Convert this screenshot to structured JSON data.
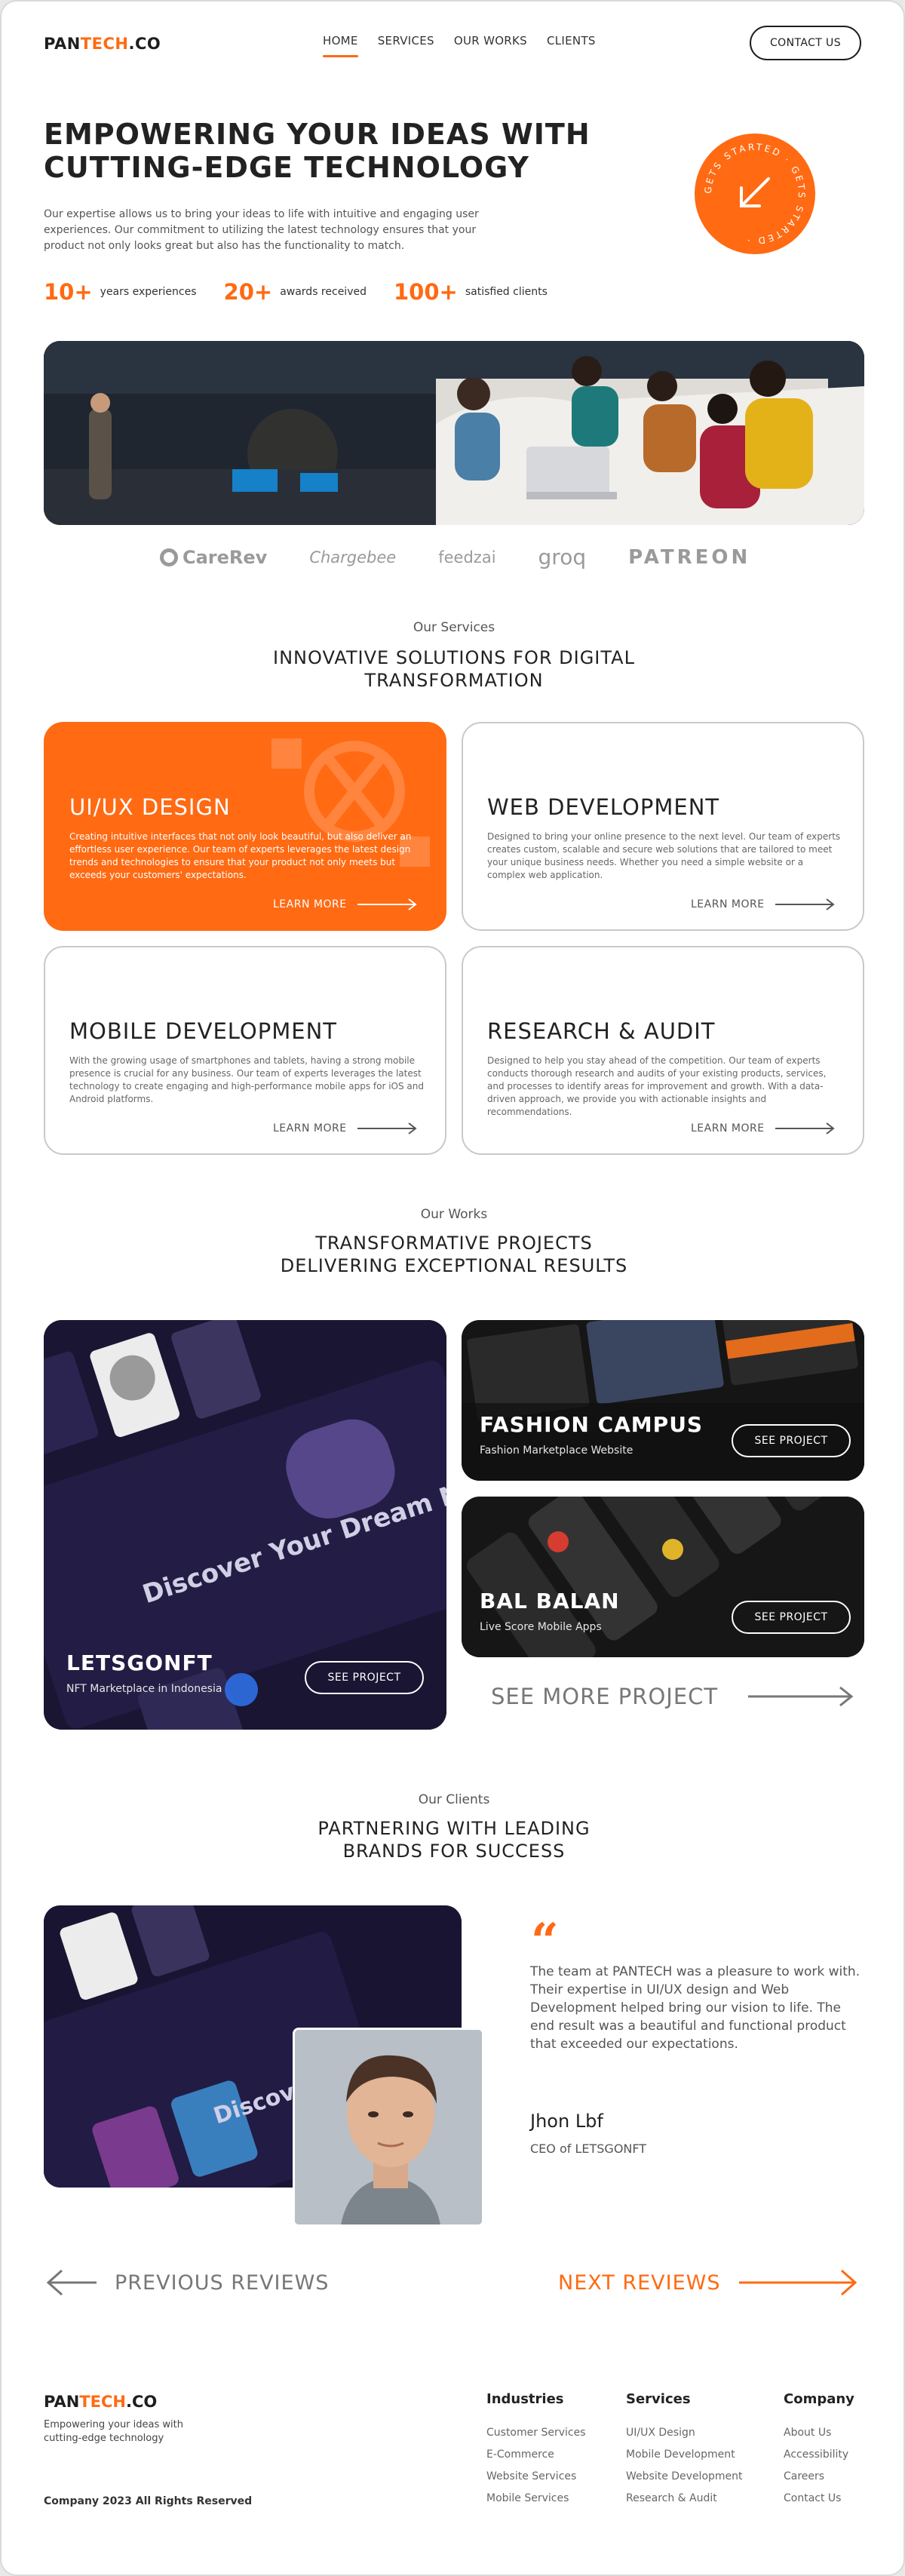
{
  "nav": {
    "logo_main": "PAN",
    "logo_accent": "TECH",
    "logo_suffix": ".CO",
    "items": [
      "HOME",
      "SERVICES",
      "OUR WORKS",
      "CLIENTS"
    ],
    "contact": "CONTACT US"
  },
  "hero": {
    "title": "EMPOWERING YOUR IDEAS WITH CUTTING-EDGE TECHNOLOGY",
    "description": "Our expertise allows us to bring your ideas to life with intuitive and engaging user experiences. Our commitment to utilizing the latest technology ensures that your product not only looks great but also has the functionality to match.",
    "badge_text": "GETS STARTED · GETS STARTED · ",
    "stats": [
      {
        "value": "10+",
        "label": "years experiences"
      },
      {
        "value": "20+",
        "label": "awards received"
      },
      {
        "value": "100+",
        "label": "satisfied clients"
      }
    ]
  },
  "brands": [
    "CareRev",
    "Chargebee",
    "feedzai",
    "groq",
    "PATREON"
  ],
  "services": {
    "kicker": "Our Services",
    "title": "INNOVATIVE SOLUTIONS FOR DIGITAL TRANSFORMATION",
    "items": [
      {
        "title": "UI/UX DESIGN",
        "desc": "Creating intuitive interfaces that not only look beautiful, but also deliver an effortless user experience. Our team of experts leverages the latest design trends and technologies to ensure that your product not only meets but exceeds your customers' expectations.",
        "link": "LEARN MORE"
      },
      {
        "title": "WEB DEVELOPMENT",
        "desc": "Designed to bring your online presence to the next level. Our team of experts creates custom, scalable and secure web solutions that are tailored to meet your unique business needs. Whether you need a simple website or a complex web application.",
        "link": "LEARN MORE"
      },
      {
        "title": "MOBILE DEVELOPMENT",
        "desc": "With the growing usage of smartphones and tablets, having a strong mobile presence is crucial for any business. Our team of experts leverages the latest technology to create engaging and high-performance mobile apps for iOS and Android platforms.",
        "link": "LEARN MORE"
      },
      {
        "title": "RESEARCH & AUDIT",
        "desc": "Designed to help you stay ahead of the competition. Our team of experts conducts thorough research and audits of your existing products, services, and processes to identify areas for improvement and growth. With a data-driven approach, we provide you with actionable insights and recommendations.",
        "link": "LEARN MORE"
      }
    ]
  },
  "works": {
    "kicker": "Our Works",
    "title_line1": "TRANSFORMATIVE PROJECTS",
    "title_line2": "DELIVERING EXCEPTIONAL RESULTS",
    "projects": [
      {
        "title": "LETSGONFT",
        "subtitle": "NFT Marketplace in Indonesia",
        "button": "SEE PROJECT",
        "art_text": "Discover Your Dream NFT's in Your Gallery"
      },
      {
        "title": "FASHION CAMPUS",
        "subtitle": "Fashion Marketplace Website",
        "button": "SEE PROJECT"
      },
      {
        "title": "BAL BALAN",
        "subtitle": "Live Score Mobile Apps",
        "button": "SEE PROJECT"
      }
    ],
    "see_more": "SEE MORE PROJECT"
  },
  "clients": {
    "kicker": "Our Clients",
    "title_line1": "PARTNERING WITH LEADING",
    "title_line2": "BRANDS FOR SUCCESS",
    "quote": "The team at PANTECH was a pleasure to work with. Their expertise in UI/UX design and Web Development helped bring our vision to life. The end result was a beautiful and functional product that exceeded our expectations.",
    "name": "Jhon Lbf",
    "role": "CEO of LETSGONFT",
    "prev": "PREVIOUS REVIEWS",
    "next": "NEXT REVIEWS"
  },
  "footer": {
    "tagline": "Empowering your ideas with cutting-edge technology",
    "copyright": "Company 2023 All Rights Reserved",
    "columns": [
      {
        "heading": "Industries",
        "links": [
          "Customer Services",
          "E-Commerce",
          "Website Services",
          "Mobile Services"
        ]
      },
      {
        "heading": "Services",
        "links": [
          "UI/UX Design",
          "Mobile Development",
          "Website Development",
          "Research & Audit"
        ]
      },
      {
        "heading": "Company",
        "links": [
          "About Us",
          "Accessibility",
          "Careers",
          "Contact Us"
        ]
      }
    ]
  },
  "colors": {
    "accent": "#ff6a13",
    "text": "#222222",
    "muted": "#777777"
  }
}
